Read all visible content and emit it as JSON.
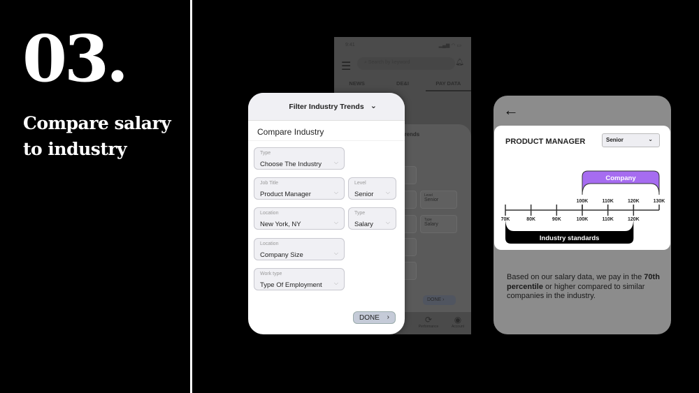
{
  "slide": {
    "number": "03.",
    "heading": "Compare salary to industry"
  },
  "back_phone": {
    "time": "9:41",
    "status": "▂▄▆ ◠ ▭",
    "search_placeholder": "Search by keyword",
    "tabs": [
      "NEWS",
      "DE&I",
      "PAY DATA"
    ],
    "active_tab": "PAY DATA",
    "modal_title": "Trends",
    "level": "Senior",
    "level_label": "Level",
    "type_label": "Type",
    "type": "Salary",
    "done": "DONE",
    "nav": [
      "Performance",
      "Account"
    ]
  },
  "filter": {
    "title": "Filter Industry Trends",
    "section": "Compare Industry",
    "fields": [
      {
        "label": "Type",
        "value": "Choose The Industry"
      },
      {
        "label": "Job Title",
        "value": "Product Manager"
      },
      {
        "label": "Level",
        "value": "Senior"
      },
      {
        "label": "Location",
        "value": "New York, NY"
      },
      {
        "label": "Type",
        "value": "Salary"
      },
      {
        "label": "Location",
        "value": "Company Size"
      },
      {
        "label": "Work type",
        "value": "Type Of Employment"
      }
    ],
    "done": "DONE"
  },
  "result": {
    "title": "PRODUCT MANAGER",
    "level": "Senior",
    "desc_pre": "Based on our salary data, we pay in the ",
    "desc_bold": "70th percentile",
    "desc_post": " or higher compared to similar companies in the industry."
  },
  "chart_data": {
    "type": "range",
    "axis_min": 70,
    "axis_max": 130,
    "unit": "K",
    "lower_ticks": [
      "70K",
      "80K",
      "90K",
      "100K",
      "110K",
      "120K"
    ],
    "upper_ticks": [
      "100K",
      "110K",
      "120K",
      "130K"
    ],
    "series": [
      {
        "name": "Company",
        "range": [
          100,
          130
        ],
        "color": "#a66cf0"
      },
      {
        "name": "Industry standards",
        "range": [
          70,
          120
        ],
        "color": "#000000"
      }
    ]
  },
  "colors": {
    "accent": "#a66cf0"
  }
}
